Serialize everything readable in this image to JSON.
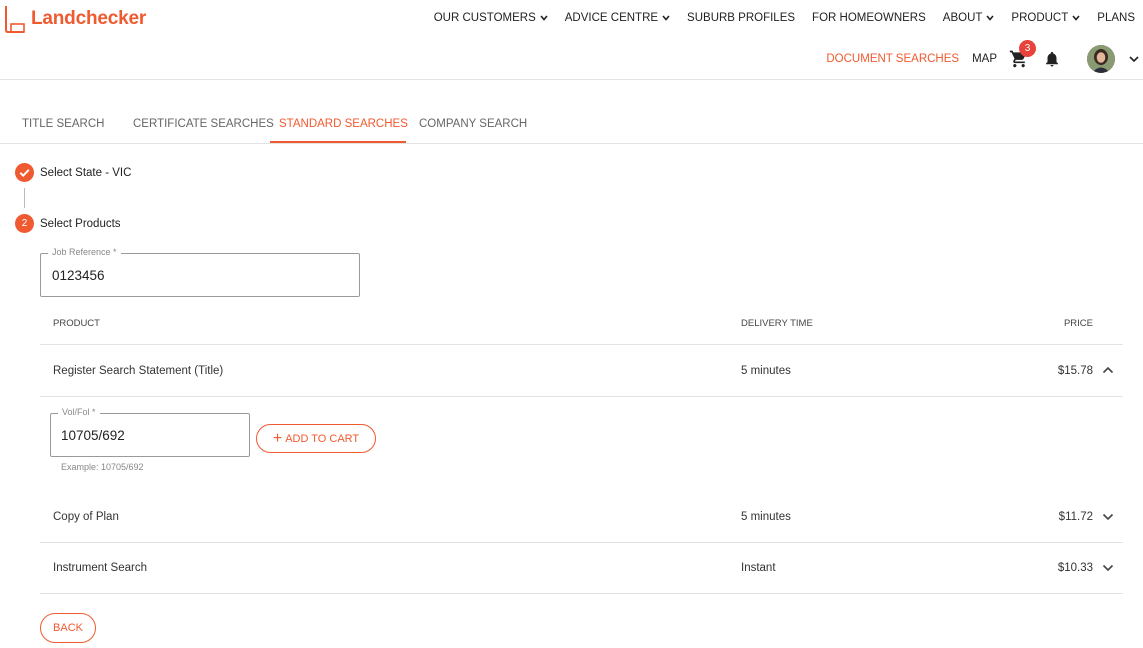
{
  "brand": {
    "name": "Landchecker",
    "accent": "#f05a30"
  },
  "nav": {
    "items": [
      {
        "label": "OUR CUSTOMERS",
        "dropdown": true
      },
      {
        "label": "ADVICE CENTRE",
        "dropdown": true
      },
      {
        "label": "SUBURB PROFILES",
        "dropdown": false
      },
      {
        "label": "FOR HOMEOWNERS",
        "dropdown": false
      },
      {
        "label": "ABOUT",
        "dropdown": true
      },
      {
        "label": "PRODUCT",
        "dropdown": true
      },
      {
        "label": "PLANS",
        "dropdown": false
      }
    ]
  },
  "subnav": {
    "document_searches": "DOCUMENT SEARCHES",
    "map": "MAP",
    "cart_count": "3",
    "icons": [
      "cart-icon",
      "bell-icon",
      "avatar",
      "chevron-down-icon"
    ]
  },
  "tabs": [
    {
      "label": "TITLE SEARCH",
      "active": false
    },
    {
      "label": "CERTIFICATE SEARCHES",
      "active": false
    },
    {
      "label": "STANDARD SEARCHES",
      "active": true
    },
    {
      "label": "COMPANY SEARCH",
      "active": false
    }
  ],
  "steps": [
    {
      "marker": "check-icon",
      "label": "Select State - VIC"
    },
    {
      "marker": "2",
      "label": "Select Products"
    }
  ],
  "job_reference": {
    "label": "Job Reference *",
    "value": "0123456"
  },
  "table": {
    "headers": {
      "product": "PRODUCT",
      "delivery": "DELIVERY TIME",
      "price": "PRICE"
    },
    "rows": [
      {
        "product": "Register Search Statement (Title)",
        "delivery": "5 minutes",
        "price": "$15.78",
        "expanded": true
      },
      {
        "product": "Copy of Plan",
        "delivery": "5 minutes",
        "price": "$11.72",
        "expanded": false
      },
      {
        "product": "Instrument Search",
        "delivery": "Instant",
        "price": "$10.33",
        "expanded": false
      }
    ]
  },
  "volfol": {
    "label": "Vol/Fol *",
    "value": "10705/692",
    "helper": "Example: 10705/692"
  },
  "buttons": {
    "add_to_cart": "ADD TO CART",
    "back": "BACK"
  }
}
